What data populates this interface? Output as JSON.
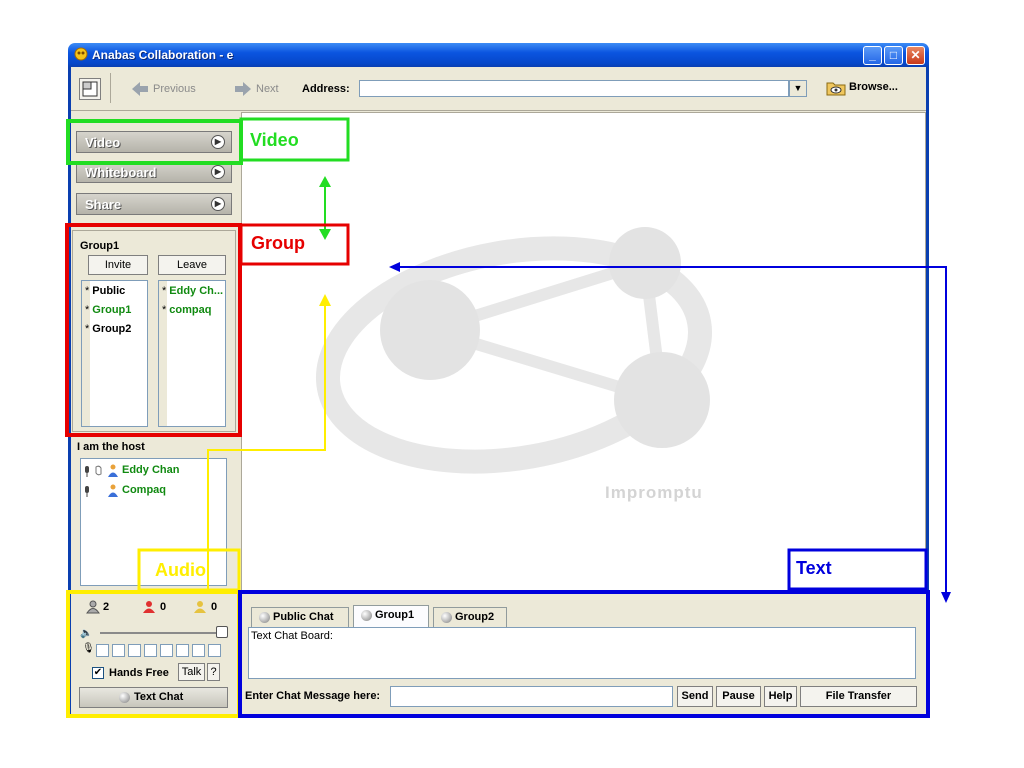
{
  "window": {
    "title": "Anabas Collaboration - e"
  },
  "toolbar": {
    "previous_label": "Previous",
    "next_label": "Next",
    "address_label": "Address:",
    "address_value": "",
    "browse_label": "Browse..."
  },
  "nav": {
    "video": "Video",
    "whiteboard": "Whiteboard",
    "share": "Share"
  },
  "group": {
    "title": "Group1",
    "invite_label": "Invite",
    "leave_label": "Leave",
    "groups": [
      "Public",
      "Group1",
      "Group2"
    ],
    "members": [
      "Eddy Ch...",
      "compaq"
    ]
  },
  "host": {
    "title": "I am the host",
    "users": [
      "Eddy Chan",
      "Compaq"
    ]
  },
  "audio": {
    "count_users": "2",
    "count_red": "0",
    "count_yellow": "0",
    "volume": 1.0,
    "hands_free_label": "Hands Free",
    "hands_free_checked": true,
    "talk_label": "Talk",
    "help_label": "?",
    "text_chat_label": "Text Chat"
  },
  "canvas": {
    "watermark": "Impromptu"
  },
  "chat": {
    "tabs": [
      "Public Chat",
      "Group1",
      "Group2"
    ],
    "active_tab": "Group1",
    "board_label": "Text Chat Board:",
    "message_label": "Enter Chat Message here:",
    "message_value": "",
    "send_label": "Send",
    "pause_label": "Pause",
    "help_label": "Help",
    "file_transfer_label": "File Transfer"
  },
  "annotations": {
    "video": "Video",
    "group": "Group",
    "audio": "Audio",
    "text": "Text",
    "colors": {
      "video": "#22dd22",
      "group": "#e60000",
      "audio": "#ffee00",
      "text": "#0000dd"
    }
  }
}
